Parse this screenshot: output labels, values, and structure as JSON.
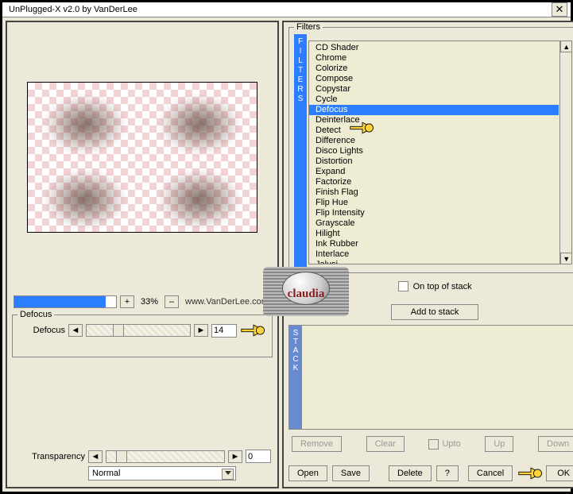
{
  "window": {
    "title": "UnPlugged-X v2.0 by VanDerLee"
  },
  "zoom": {
    "percent": "33%",
    "fill_pct": 90,
    "plus": "+",
    "minus": "–",
    "link": "www.VanDerLee.com"
  },
  "defocus_group": {
    "label": "Defocus",
    "param_label": "Defocus",
    "value": "14",
    "thumb_pct": 25
  },
  "transparency": {
    "label": "Transparency",
    "value": "0",
    "thumb_pct": 8,
    "blend_mode": "Normal"
  },
  "filters": {
    "group_label": "Filters",
    "vert_label": "FILTERS",
    "items": [
      "CD Shader",
      "Chrome",
      "Colorize",
      "Compose",
      "Copystar",
      "Cycle",
      "Defocus",
      "Deinterlace",
      "Detect",
      "Difference",
      "Disco Lights",
      "Distortion",
      "Expand",
      "Factorize",
      "Finish Flag",
      "Flip Hue",
      "Flip Intensity",
      "Grayscale",
      "Hilight",
      "Ink Rubber",
      "Interlace",
      "Jalusi"
    ],
    "selected_index": 6,
    "ontop_label": "On top of stack"
  },
  "stack": {
    "add_label": "Add to stack",
    "vert_label": "STACK",
    "remove": "Remove",
    "clear": "Clear",
    "upto": "Upto",
    "up": "Up",
    "down": "Down"
  },
  "bottom": {
    "open": "Open",
    "save": "Save",
    "delete": "Delete",
    "help": "?",
    "cancel": "Cancel",
    "ok": "OK"
  },
  "badge": {
    "text": "claudia"
  }
}
